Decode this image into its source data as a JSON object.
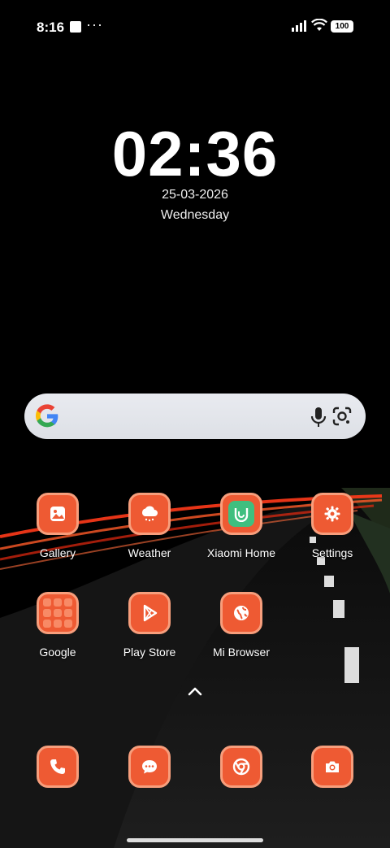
{
  "status_bar": {
    "time": "8:16",
    "more": "···",
    "battery": "100"
  },
  "widget": {
    "clock": "02:36",
    "date": "25-03-2026",
    "weekday": "Wednesday"
  },
  "search": {
    "icons": [
      "google-logo",
      "mic-icon",
      "lens-icon"
    ]
  },
  "apps": [
    {
      "label": "Gallery",
      "icon": "gallery-icon"
    },
    {
      "label": "Weather",
      "icon": "weather-icon"
    },
    {
      "label": "Xiaomi Home",
      "icon": "xiaomi-home-icon"
    },
    {
      "label": "Settings",
      "icon": "settings-icon"
    },
    {
      "label": "Google",
      "icon": "google-folder-icon"
    },
    {
      "label": "Play Store",
      "icon": "play-store-icon"
    },
    {
      "label": "Mi Browser",
      "icon": "browser-icon"
    }
  ],
  "dock": [
    {
      "icon": "phone-icon"
    },
    {
      "icon": "messages-icon"
    },
    {
      "icon": "chrome-icon"
    },
    {
      "icon": "camera-icon"
    }
  ],
  "colors": {
    "icon_bg": "#ee5a33",
    "icon_border": "#f79e7c",
    "xiaomi_home_bg": "#3fbf7f"
  }
}
